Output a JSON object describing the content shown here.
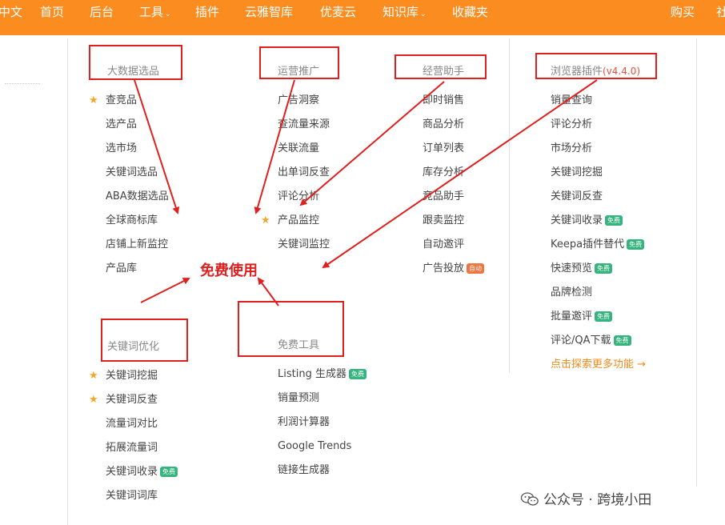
{
  "nav": {
    "items": [
      {
        "label": "中文"
      },
      {
        "label": "首页"
      },
      {
        "label": "后台"
      },
      {
        "label": "工具",
        "caret": "⌄"
      },
      {
        "label": "插件"
      },
      {
        "label": "云雅智库"
      },
      {
        "label": "优麦云"
      },
      {
        "label": "知识库",
        "caret": "⌄"
      },
      {
        "label": "收藏夹"
      },
      {
        "label": "购买"
      },
      {
        "label": "社"
      }
    ]
  },
  "sections": {
    "bigdata": {
      "title": "大数据选品",
      "items": [
        {
          "label": "查竞品",
          "star": "★"
        },
        {
          "label": "选产品"
        },
        {
          "label": "选市场"
        },
        {
          "label": "关键词选品"
        },
        {
          "label": "ABA数据选品"
        },
        {
          "label": "全球商标库"
        },
        {
          "label": "店铺上新监控"
        },
        {
          "label": "产品库"
        }
      ]
    },
    "ops": {
      "title": "运营推广",
      "items": [
        {
          "label": "广告洞察"
        },
        {
          "label": "查流量来源"
        },
        {
          "label": "关联流量"
        },
        {
          "label": "出单词反查"
        },
        {
          "label": "评论分析"
        },
        {
          "label": "产品监控",
          "star": "★"
        },
        {
          "label": "关键词监控"
        }
      ]
    },
    "assistant": {
      "title": "经营助手",
      "items": [
        {
          "label": "即时销售"
        },
        {
          "label": "商品分析"
        },
        {
          "label": "订单列表"
        },
        {
          "label": "库存分析"
        },
        {
          "label": "竞品助手"
        },
        {
          "label": "跟卖监控"
        },
        {
          "label": "自动邀评"
        },
        {
          "label": "广告投放",
          "badge": "自动"
        }
      ]
    },
    "plugin": {
      "title": "浏览器插件",
      "version": "(v4.4.0)",
      "items": [
        {
          "label": "销量查询"
        },
        {
          "label": "评论分析"
        },
        {
          "label": "市场分析"
        },
        {
          "label": "关键词挖掘"
        },
        {
          "label": "关键词反查"
        },
        {
          "label": "关键词收录",
          "badge": "免费"
        },
        {
          "label": "Keepa插件替代",
          "badge": "免费"
        },
        {
          "label": "快速预览",
          "badge": "免费"
        },
        {
          "label": "品牌检测"
        },
        {
          "label": "批量邀评",
          "badge": "免费"
        },
        {
          "label": "评论/QA下载",
          "badge": "免费"
        }
      ],
      "more": "点击探索更多功能 →"
    },
    "keyword": {
      "title": "关键词优化",
      "items": [
        {
          "label": "关键词挖掘",
          "star": "★"
        },
        {
          "label": "关键词反查",
          "star": "★"
        },
        {
          "label": "流量词对比"
        },
        {
          "label": "拓展流量词"
        },
        {
          "label": "关键词收录",
          "badge": "免费"
        },
        {
          "label": "关键词词库"
        }
      ]
    },
    "free": {
      "title": "免费工具",
      "items": [
        {
          "label": "Listing 生成器",
          "badge": "免费"
        },
        {
          "label": "销量预测"
        },
        {
          "label": "利润计算器"
        },
        {
          "label": "Google Trends"
        },
        {
          "label": "链接生成器"
        }
      ]
    }
  },
  "annotation": {
    "free_use": "免费使用"
  },
  "watermark": {
    "text": "公众号 · 跨境小田"
  },
  "colors": {
    "topbar": "#fb8c20",
    "annotation_red": "#e0201f",
    "badge_green": "#36b37e",
    "badge_orange": "#f0743e",
    "link_orange": "#f08a1c",
    "star": "#f5a623"
  }
}
